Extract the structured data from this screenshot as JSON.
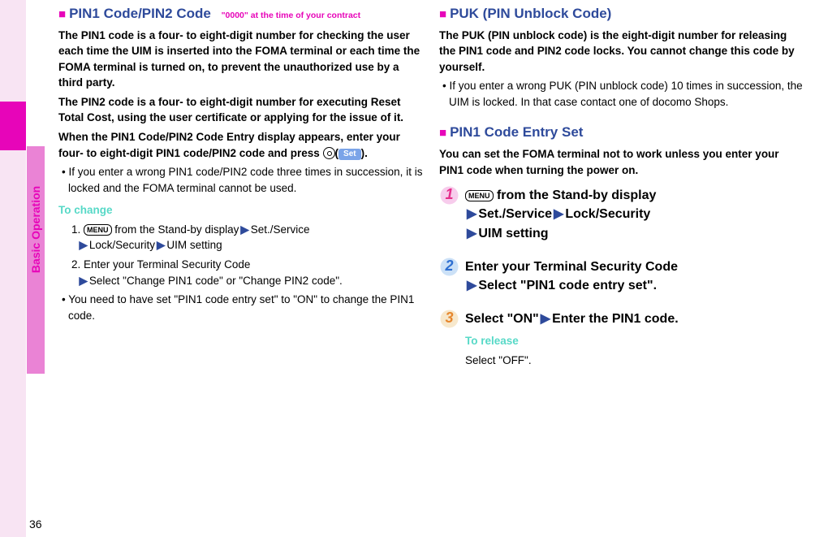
{
  "side_tab": "Basic Operation",
  "page_number": "36",
  "left": {
    "title": "PIN1 Code/PIN2 Code",
    "contract_note": "\"0000\" at the time of your contract",
    "p1": "The PIN1 code is a four- to eight-digit number for checking the user each time the UIM is inserted into the FOMA terminal or each time the FOMA terminal is turned on, to prevent the unauthorized use by a third party.",
    "p2": "The PIN2 code is a four- to eight-digit number for executing Reset Total Cost, using the user certificate or applying for the issue of it.",
    "p3a": "When the PIN1 Code/PIN2 Code Entry display appears, enter your four- to eight-digit PIN1 code/PIN2 code and press ",
    "p3b_set": "Set",
    "p3c": ").",
    "bullet1": "• If you enter a wrong PIN1 code/PIN2 code three times in succession, it is locked and the FOMA terminal cannot be used.",
    "to_change": "To change",
    "ch1a": "1.",
    "ch1_menu": "MENU",
    "ch1b": " from the Stand-by display",
    "ch1c": "Set./Service",
    "ch1d": "Lock/Security",
    "ch1e": "UIM setting",
    "ch2": "2. Enter your Terminal Security Code",
    "ch2b": "Select \"Change PIN1 code\" or \"Change PIN2 code\".",
    "note": "• You need to have set \"PIN1 code entry set\" to \"ON\" to change the PIN1 code."
  },
  "right": {
    "puk_title": "PUK (PIN Unblock Code)",
    "puk_p1": "The PUK (PIN unblock code) is the eight-digit number for releasing the PIN1 code and PIN2 code locks. You cannot change this code by yourself.",
    "puk_bullet": "• If you enter a wrong PUK (PIN unblock code) 10 times in succession, the UIM is locked. In that case contact one of docomo Shops.",
    "entry_title": "PIN1 Code Entry Set",
    "entry_p1": "You can set the FOMA terminal not to work unless you enter your PIN1 code when turning the power on.",
    "step1_menu": "MENU",
    "step1a": " from the Stand-by display",
    "step1b": "Set./Service",
    "step1c": "Lock/Security",
    "step1d": "UIM setting",
    "step2a": "Enter your Terminal Security Code",
    "step2b": "Select \"PIN1 code entry set\".",
    "step3a": "Select \"ON\"",
    "step3b": "Enter the PIN1 code.",
    "to_release": "To release",
    "release_text": "Select \"OFF\".",
    "nums": {
      "n1": "1",
      "n2": "2",
      "n3": "3"
    }
  }
}
